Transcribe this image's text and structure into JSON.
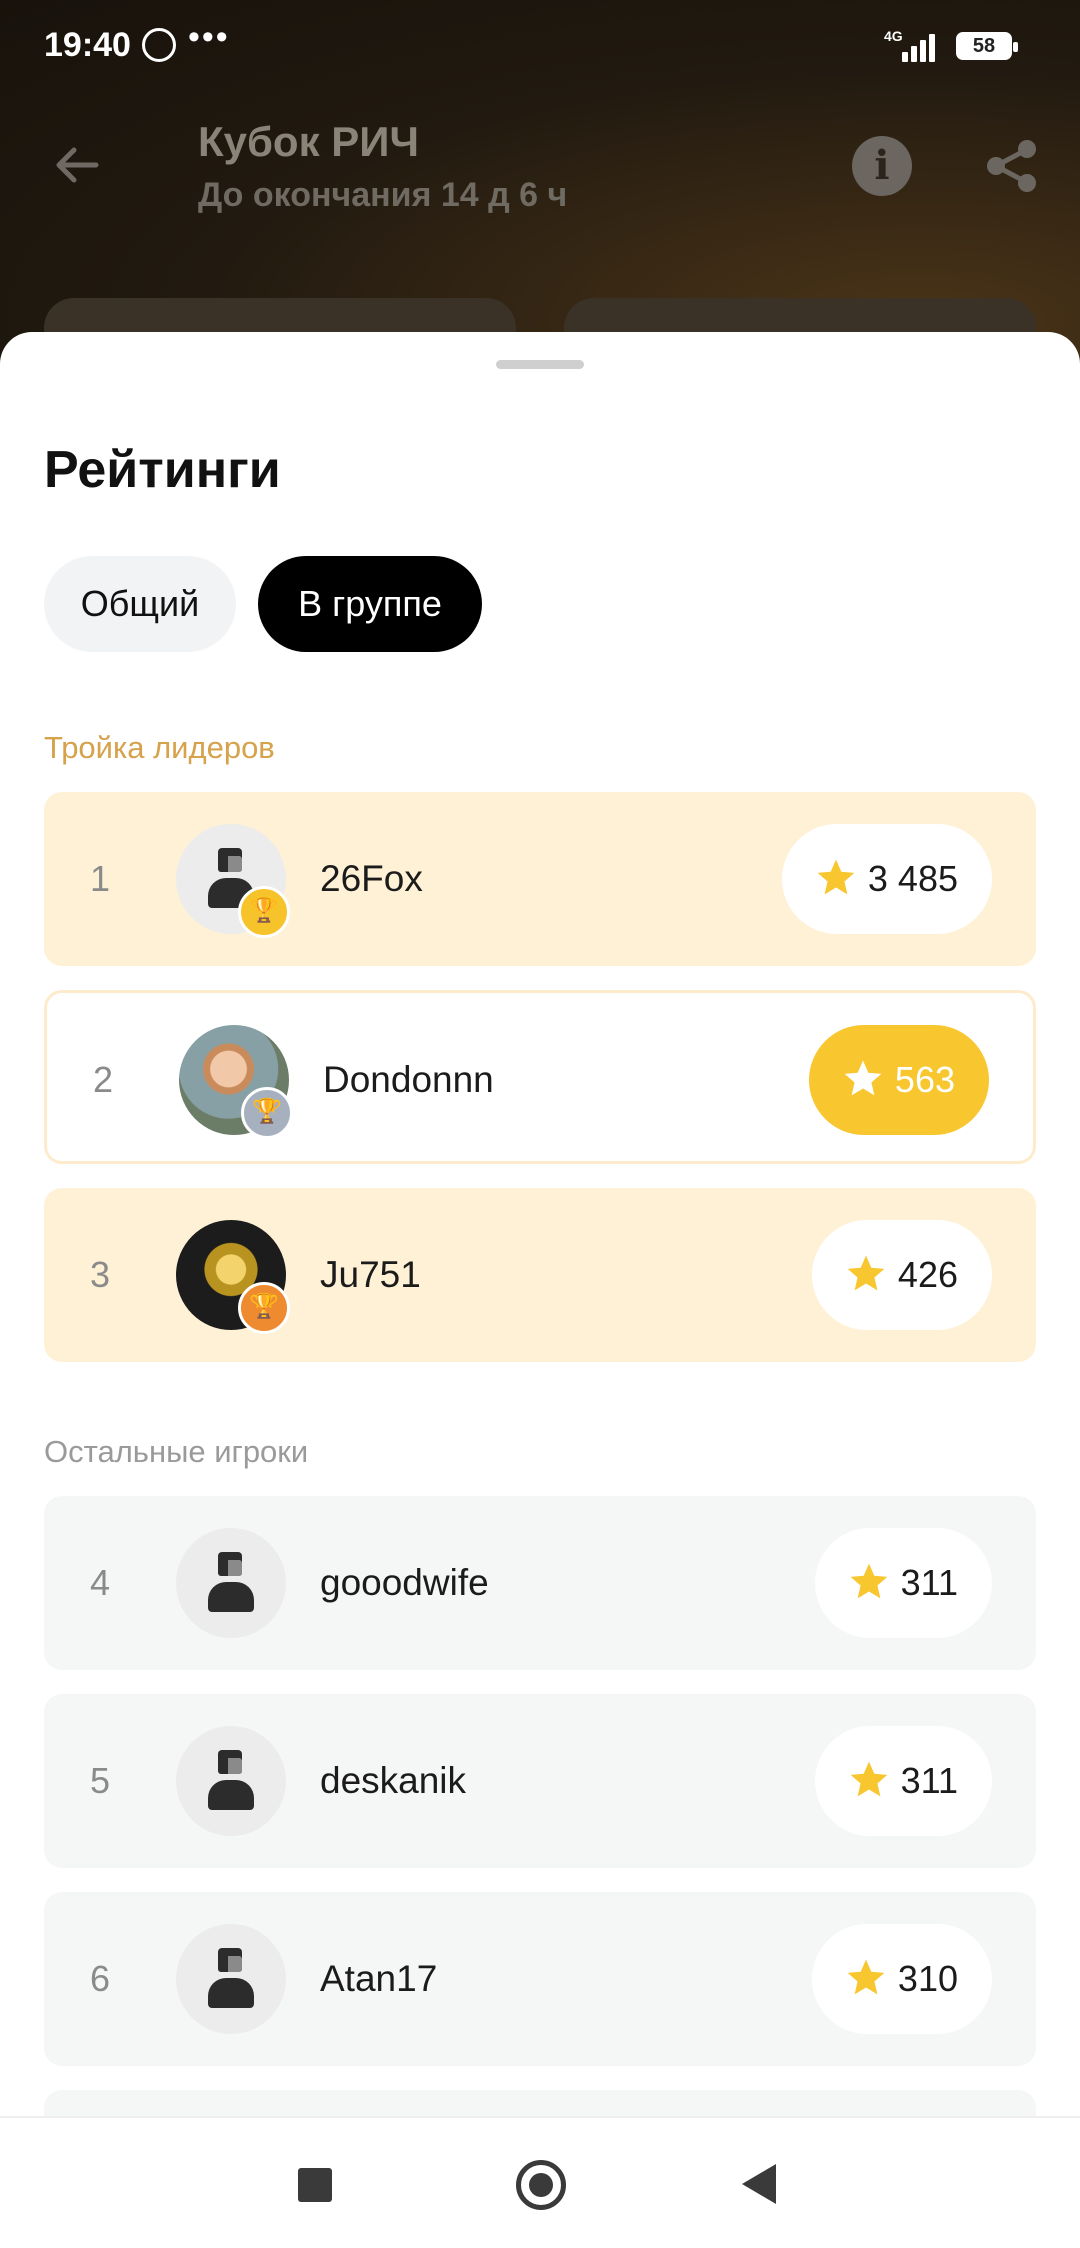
{
  "status_bar": {
    "time": "19:40",
    "dots": "•••",
    "network": "4G",
    "battery": "58"
  },
  "header": {
    "title": "Кубок РИЧ",
    "subtitle": "До окончания 14 д 6 ч"
  },
  "sheet": {
    "title": "Рейтинги",
    "tabs": [
      {
        "label": "Общий",
        "selected": false
      },
      {
        "label": "В группе",
        "selected": true
      }
    ],
    "section_top": "Тройка лидеров",
    "section_rest": "Остальные игроки",
    "leaders": [
      {
        "rank": "1",
        "name": "26Fox",
        "score": "3 485",
        "medal": "gold"
      },
      {
        "rank": "2",
        "name": "Dondonnn",
        "score": "563",
        "medal": "silver"
      },
      {
        "rank": "3",
        "name": "Ju751",
        "score": "426",
        "medal": "bronze"
      }
    ],
    "others": [
      {
        "rank": "4",
        "name": "gooodwife",
        "score": "311"
      },
      {
        "rank": "5",
        "name": "deskanik",
        "score": "311"
      },
      {
        "rank": "6",
        "name": "Atan17",
        "score": "310"
      }
    ]
  },
  "colors": {
    "accent": "#f8c62f",
    "leader_bg": "#fff1d6",
    "tab_selected": "#000000"
  },
  "icons": [
    "whatsapp-icon",
    "back-arrow-icon",
    "info-icon",
    "share-icon",
    "star-icon",
    "trophy-icon",
    "person-icon"
  ]
}
